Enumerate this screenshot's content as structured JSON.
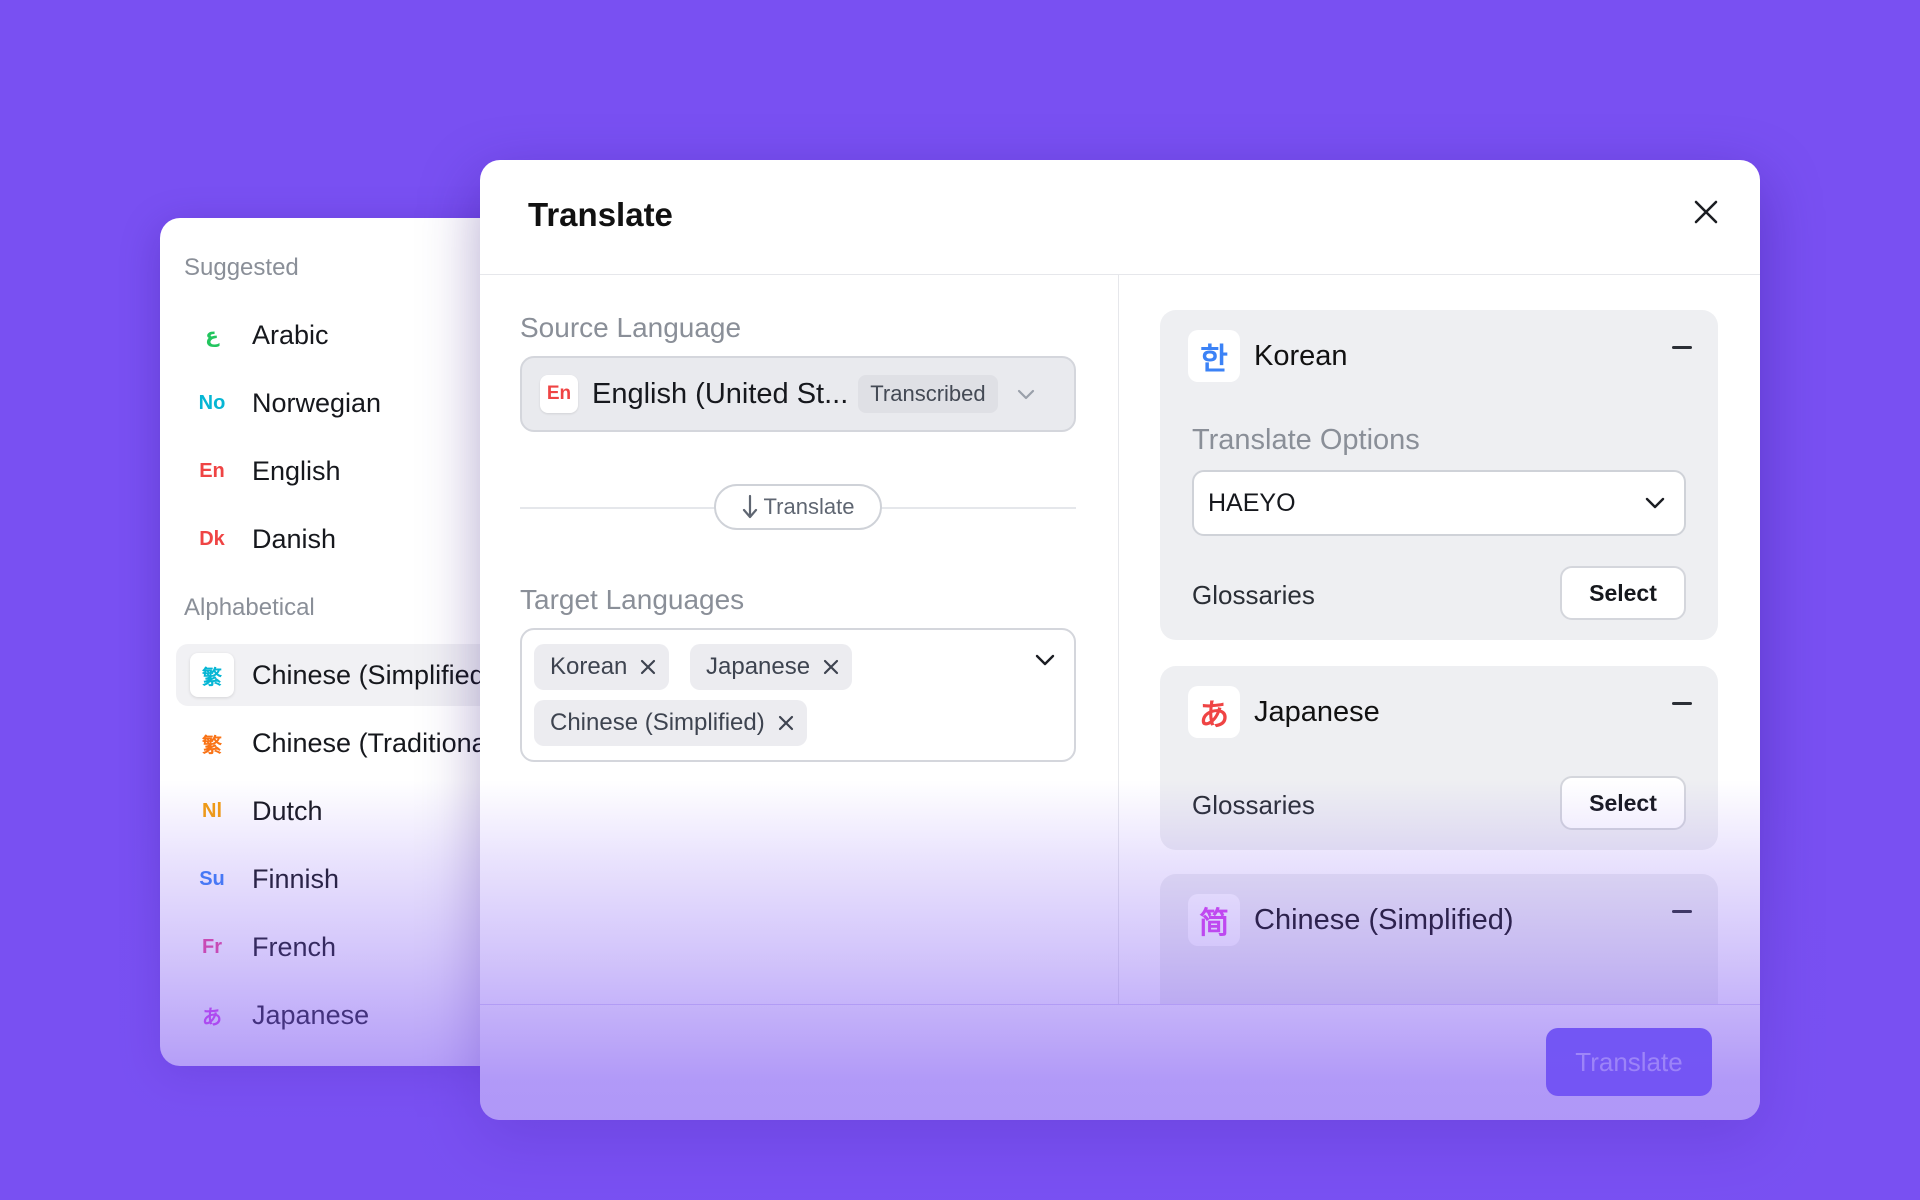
{
  "language_list": {
    "suggested_label": "Suggested",
    "alphabetical_label": "Alphabetical",
    "suggested": [
      {
        "code": "ع",
        "name": "Arabic",
        "color": "#22c55e"
      },
      {
        "code": "No",
        "name": "Norwegian",
        "color": "#06b6d4"
      },
      {
        "code": "En",
        "name": "English",
        "color": "#ef4444"
      },
      {
        "code": "Dk",
        "name": "Danish",
        "color": "#ef4444"
      }
    ],
    "alphabetical": [
      {
        "code": "繁",
        "name": "Chinese (Simplified)",
        "color": "#06b6d4",
        "selected": true
      },
      {
        "code": "繁",
        "name": "Chinese (Traditional)",
        "color": "#f97316"
      },
      {
        "code": "Nl",
        "name": "Dutch",
        "color": "#f59e0b"
      },
      {
        "code": "Su",
        "name": "Finnish",
        "color": "#3b82f6"
      },
      {
        "code": "Fr",
        "name": "French",
        "color": "#ec4899"
      },
      {
        "code": "あ",
        "name": "Japanese",
        "color": "#d946ef"
      }
    ]
  },
  "modal": {
    "title": "Translate",
    "source": {
      "label": "Source Language",
      "flag": "En",
      "value": "English (United St...",
      "badge": "Transcribed"
    },
    "translate_pill": "Translate",
    "target": {
      "label": "Target Languages",
      "chips": [
        "Korean",
        "Japanese",
        "Chinese (Simplified)"
      ]
    },
    "cards": [
      {
        "flag": "한",
        "flag_color": "#3b82f6",
        "title": "Korean",
        "options_label": "Translate Options",
        "option_value": "HAEYO",
        "glossaries_label": "Glossaries",
        "select_label": "Select"
      },
      {
        "flag": "あ",
        "flag_color": "#ef4444",
        "title": "Japanese",
        "glossaries_label": "Glossaries",
        "select_label": "Select"
      },
      {
        "flag": "简",
        "flag_color": "#d946ef",
        "title": "Chinese (Simplified)"
      }
    ],
    "primary_button": "Translate"
  },
  "colors": {
    "background": "#7950f2",
    "primary": "#6d5cf6"
  }
}
